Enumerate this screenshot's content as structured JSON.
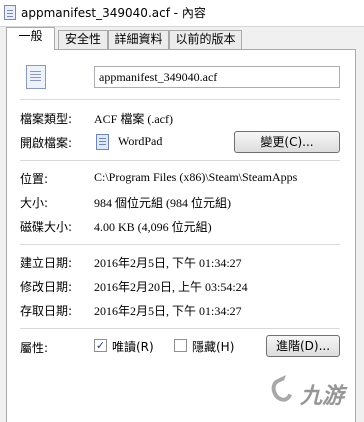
{
  "window": {
    "title": "appmanifest_349040.acf - 內容",
    "icon": "document-icon"
  },
  "tabs": [
    {
      "label": "一般",
      "active": true
    },
    {
      "label": "安全性",
      "active": false
    },
    {
      "label": "詳細資料",
      "active": false
    },
    {
      "label": "以前的版本",
      "active": false
    }
  ],
  "general": {
    "filename": "appmanifest_349040.acf",
    "file_type_label": "檔案類型:",
    "file_type_value": "ACF 檔案 (.acf)",
    "opens_with_label": "開啟檔案:",
    "opens_with_value": "WordPad",
    "change_button": "變更(C)...",
    "location_label": "位置:",
    "location_value": "C:\\Program Files (x86)\\Steam\\SteamApps",
    "size_label": "大小:",
    "size_value": "984 個位元組 (984 位元組)",
    "disk_size_label": "磁碟大小:",
    "disk_size_value": "4.00 KB (4,096 位元組)",
    "created_label": "建立日期:",
    "created_value": "2016年2月5日, 下午 01:34:27",
    "modified_label": "修改日期:",
    "modified_value": "2016年2月20日, 上午 03:54:24",
    "accessed_label": "存取日期:",
    "accessed_value": "2016年2月5日, 下午 01:34:27",
    "attributes_label": "屬性:",
    "readonly_label": "唯讀(R)",
    "readonly_checked": true,
    "hidden_label": "隱藏(H)",
    "hidden_checked": false,
    "advanced_button": "進階(D)..."
  },
  "watermark": {
    "text": "九游"
  }
}
